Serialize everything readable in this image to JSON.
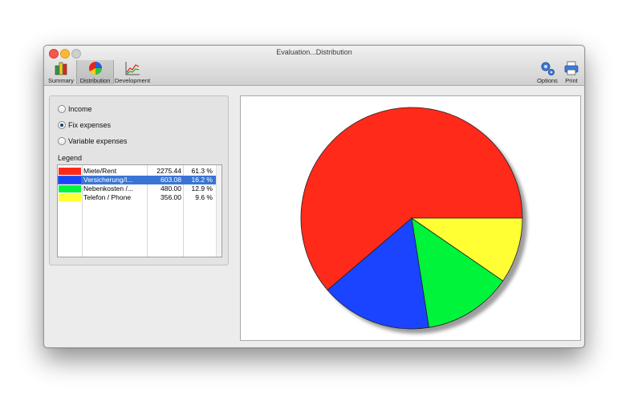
{
  "window": {
    "title": "Evaluation...Distribution"
  },
  "toolbar": {
    "summary_label": "Summary",
    "distribution_label": "Distribution",
    "development_label": "Development",
    "options_label": "Options",
    "print_label": "Print"
  },
  "selection": {
    "options": [
      {
        "label": "Income",
        "checked": false
      },
      {
        "label": "Fix expenses",
        "checked": true
      },
      {
        "label": "Variable expenses",
        "checked": false
      }
    ]
  },
  "legend": {
    "title": "Legend",
    "rows": [
      {
        "name": "Miete/Rent",
        "amount": "2275.44",
        "percent": "61.3 %",
        "color": "#ff2a1a",
        "selected": false
      },
      {
        "name": "Versicherung/I...",
        "amount": "603.08",
        "percent": "16.2 %",
        "color": "#1a44ff",
        "selected": true
      },
      {
        "name": "Nebenkosten /...",
        "amount": "480.00",
        "percent": "12.9 %",
        "color": "#00f53a",
        "selected": false
      },
      {
        "name": "Telefon / Phone",
        "amount": "356.00",
        "percent": "9.6 %",
        "color": "#ffff33",
        "selected": false
      }
    ]
  },
  "chart_data": {
    "type": "pie",
    "categories": [
      "Miete/Rent",
      "Versicherung/I...",
      "Nebenkosten /...",
      "Telefon / Phone"
    ],
    "values": [
      2275.44,
      603.08,
      480.0,
      356.0
    ],
    "colors": [
      "#ff2a1a",
      "#1a44ff",
      "#00f53a",
      "#ffff33"
    ]
  }
}
